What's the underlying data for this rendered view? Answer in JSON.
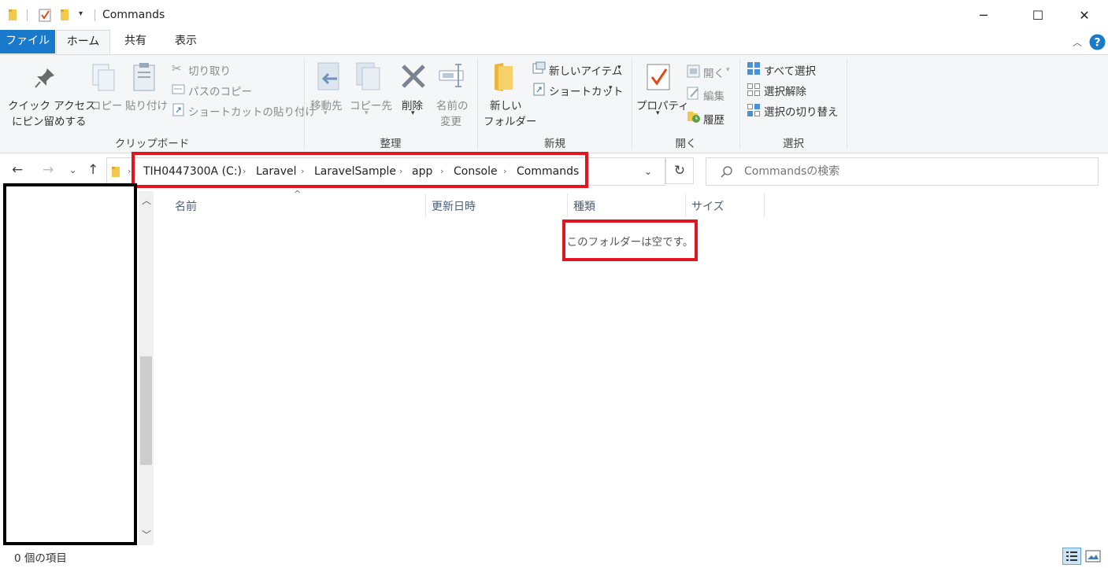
{
  "window": {
    "title": "Commands",
    "controls": {
      "minimize": "─",
      "maximize": "☐",
      "close": "✕"
    }
  },
  "tabs": [
    {
      "label": "ファイル"
    },
    {
      "label": "ホーム"
    },
    {
      "label": "共有"
    },
    {
      "label": "表示"
    }
  ],
  "ribbon": {
    "clipboard": {
      "pin_line1": "クイック アクセス",
      "pin_line2": "にピン留めする",
      "copy": "コピー",
      "paste": "貼り付け",
      "cut": "切り取り",
      "copy_path": "パスのコピー",
      "paste_shortcut": "ショートカットの貼り付け",
      "label": "クリップボード"
    },
    "organize": {
      "move_to": "移動先",
      "copy_to": "コピー先",
      "delete": "削除",
      "rename_line1": "名前の",
      "rename_line2": "変更",
      "label": "整理"
    },
    "new": {
      "new_folder_line1": "新しい",
      "new_folder_line2": "フォルダー",
      "new_item": "新しいアイテム",
      "shortcut": "ショートカット",
      "label": "新規"
    },
    "open": {
      "properties": "プロパティ",
      "open": "開く",
      "edit": "編集",
      "history": "履歴",
      "label": "開く"
    },
    "select": {
      "select_all": "すべて選択",
      "select_none": "選択解除",
      "invert": "選択の切り替え",
      "label": "選択"
    }
  },
  "address": {
    "crumbs": [
      "TIH0447300A (C:)",
      "Laravel",
      "LaravelSample",
      "app",
      "Console",
      "Commands"
    ],
    "search_placeholder": "Commandsの検索"
  },
  "columns": [
    "名前",
    "更新日時",
    "種類",
    "サイズ"
  ],
  "content": {
    "empty_message": "このフォルダーは空です。"
  },
  "status": {
    "item_count": "0 個の項目"
  },
  "colors": {
    "file_tab": "#1979ca",
    "highlight_red": "#e3141c",
    "help": "#1979ca"
  }
}
